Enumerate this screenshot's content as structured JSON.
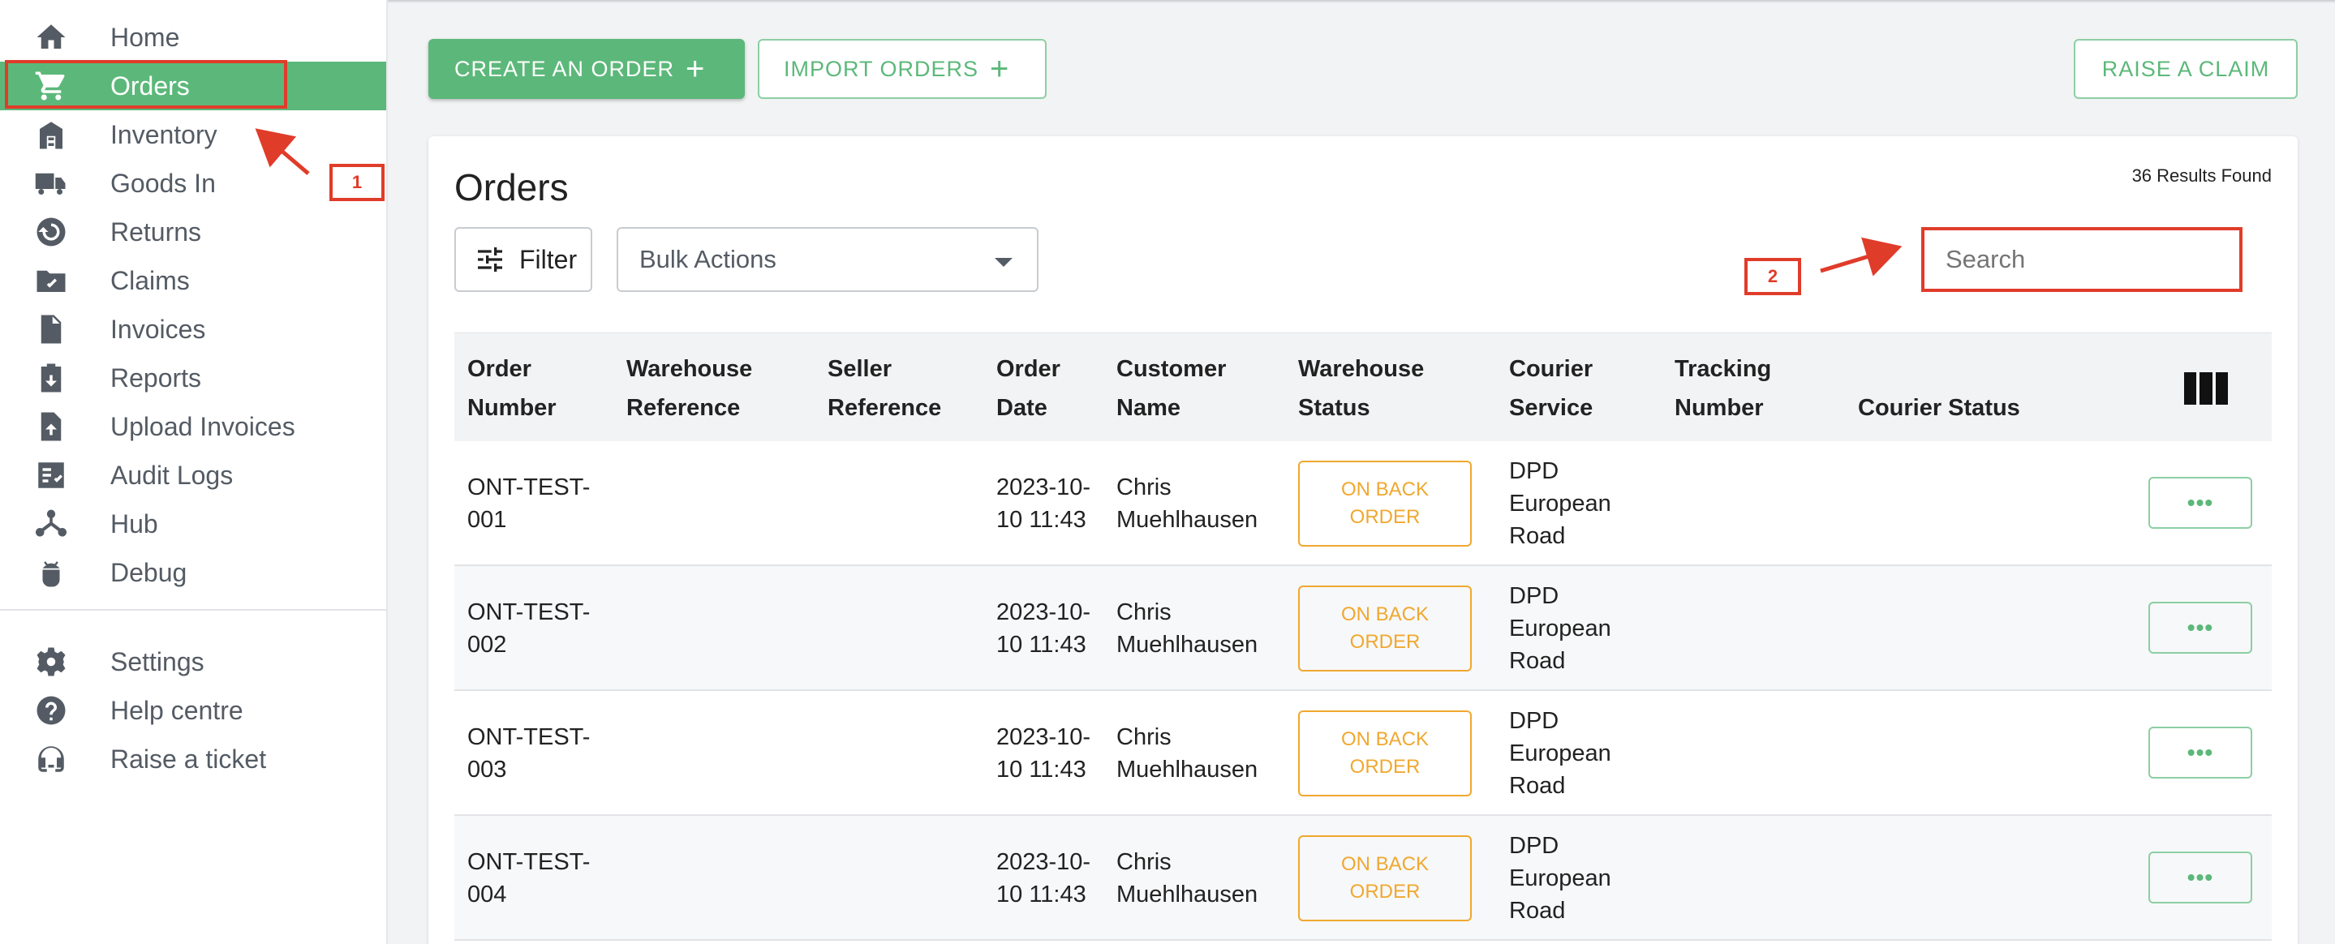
{
  "sidebar": {
    "items": [
      {
        "label": "Home",
        "icon": "home-icon"
      },
      {
        "label": "Orders",
        "icon": "cart-icon",
        "active": true
      },
      {
        "label": "Inventory",
        "icon": "warehouse-icon"
      },
      {
        "label": "Goods In",
        "icon": "truck-icon"
      },
      {
        "label": "Returns",
        "icon": "returns-icon"
      },
      {
        "label": "Claims",
        "icon": "folder-check-icon"
      },
      {
        "label": "Invoices",
        "icon": "file-icon"
      },
      {
        "label": "Reports",
        "icon": "clipboard-download-icon"
      },
      {
        "label": "Upload Invoices",
        "icon": "file-upload-icon"
      },
      {
        "label": "Audit Logs",
        "icon": "list-check-icon"
      },
      {
        "label": "Hub",
        "icon": "hub-icon"
      },
      {
        "label": "Debug",
        "icon": "android-icon"
      }
    ],
    "bottom_items": [
      {
        "label": "Settings",
        "icon": "gear-icon"
      },
      {
        "label": "Help centre",
        "icon": "help-icon"
      },
      {
        "label": "Raise a ticket",
        "icon": "headset-icon"
      }
    ]
  },
  "toolbar": {
    "create_label": "CREATE AN ORDER",
    "import_label": "IMPORT ORDERS",
    "claim_label": "RAISE A CLAIM"
  },
  "orders": {
    "title": "Orders",
    "results": "36 Results Found",
    "filter_label": "Filter",
    "bulk_actions": "Bulk Actions",
    "search_placeholder": "Search",
    "columns": [
      [
        "Order",
        "Number"
      ],
      [
        "Warehouse",
        "Reference"
      ],
      [
        "Seller",
        "Reference"
      ],
      [
        "Order",
        "Date"
      ],
      [
        "Customer",
        "Name"
      ],
      [
        "Warehouse",
        "Status"
      ],
      [
        "Courier",
        "Service"
      ],
      [
        "Tracking",
        "Number"
      ],
      [
        "",
        "Courier Status"
      ]
    ],
    "rows": [
      {
        "order_number": [
          "ONT-TEST-",
          "001"
        ],
        "order_date": [
          "2023-10-",
          "10 11:43"
        ],
        "customer": [
          "Chris",
          "Muehlhausen"
        ],
        "status": [
          "ON BACK",
          "ORDER"
        ],
        "courier": [
          "DPD",
          "European",
          "Road"
        ],
        "more": "•••"
      },
      {
        "order_number": [
          "ONT-TEST-",
          "002"
        ],
        "order_date": [
          "2023-10-",
          "10 11:43"
        ],
        "customer": [
          "Chris",
          "Muehlhausen"
        ],
        "status": [
          "ON BACK",
          "ORDER"
        ],
        "courier": [
          "DPD",
          "European",
          "Road"
        ],
        "more": "•••"
      },
      {
        "order_number": [
          "ONT-TEST-",
          "003"
        ],
        "order_date": [
          "2023-10-",
          "10 11:43"
        ],
        "customer": [
          "Chris",
          "Muehlhausen"
        ],
        "status": [
          "ON BACK",
          "ORDER"
        ],
        "courier": [
          "DPD",
          "European",
          "Road"
        ],
        "more": "•••"
      },
      {
        "order_number": [
          "ONT-TEST-",
          "004"
        ],
        "order_date": [
          "2023-10-",
          "10 11:43"
        ],
        "customer": [
          "Chris",
          "Muehlhausen"
        ],
        "status": [
          "ON BACK",
          "ORDER"
        ],
        "courier": [
          "DPD",
          "European",
          "Road"
        ],
        "more": "•••"
      }
    ]
  },
  "annotations": {
    "marker_1": "1",
    "marker_2": "2"
  },
  "colors": {
    "accent": "#5cb87a",
    "annotation": "#e03c2a",
    "status_warning": "#f0a830"
  }
}
